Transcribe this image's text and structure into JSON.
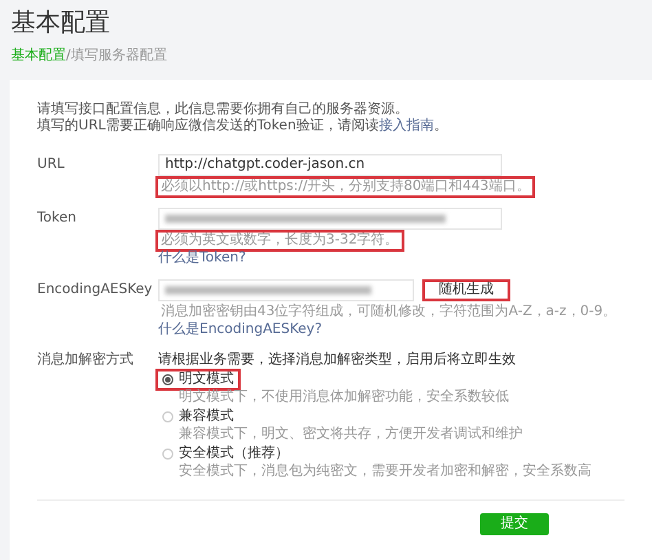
{
  "title": "基本配置",
  "breadcrumb": [
    {
      "label": "基本配置",
      "selected": true
    },
    {
      "label": "填写服务器配置",
      "selected": false
    }
  ],
  "breadcrumb_separator": "/",
  "intro": [
    "请填写接口配置信息，此信息需要你拥有自己的服务器资源。",
    "填写的URL需要正确响应微信发送的Token验证，请阅读**接入指南**。"
  ],
  "fields": [
    {
      "label": "URL",
      "value": "http://chatgpt.coder-jason.cn",
      "blurred": false,
      "hint": "必须以http://或https://开头，分别支持80端口和443端口。",
      "hint_highlighted": true
    },
    {
      "label": "Token",
      "blurred": true,
      "hint": "必须为英文或数字，长度为3-32字符。",
      "hint_highlighted": true,
      "link": "什么是Token?"
    },
    {
      "label": "EncodingAESKey",
      "blurred": true,
      "button": "随机生成",
      "button_highlighted": true,
      "hint": "消息加密密钥由43位字符组成，可随机修改，字符范围为A-Z，a-z，0-9。",
      "hint_highlighted": false,
      "link": "什么是EncodingAESKey?"
    }
  ],
  "mode": {
    "label": "消息加解密方式",
    "description": "请根据业务需要，选择消息加解密类型，启用后将立即生效",
    "options": [
      {
        "label": "明文模式",
        "selected": true,
        "highlighted": true,
        "note": "明文模式下，不使用消息体加解密功能，安全系数较低"
      },
      {
        "label": "兼容模式",
        "selected": false,
        "highlighted": false,
        "note": "兼容模式下，明文、密文将共存，方便开发者调试和维护"
      },
      {
        "label": "安全模式（推荐）",
        "selected": false,
        "highlighted": false,
        "note": "安全模式下，消息包为纯密文，需要开发者加密和解密，安全系数高"
      }
    ]
  },
  "submit": "提交"
}
